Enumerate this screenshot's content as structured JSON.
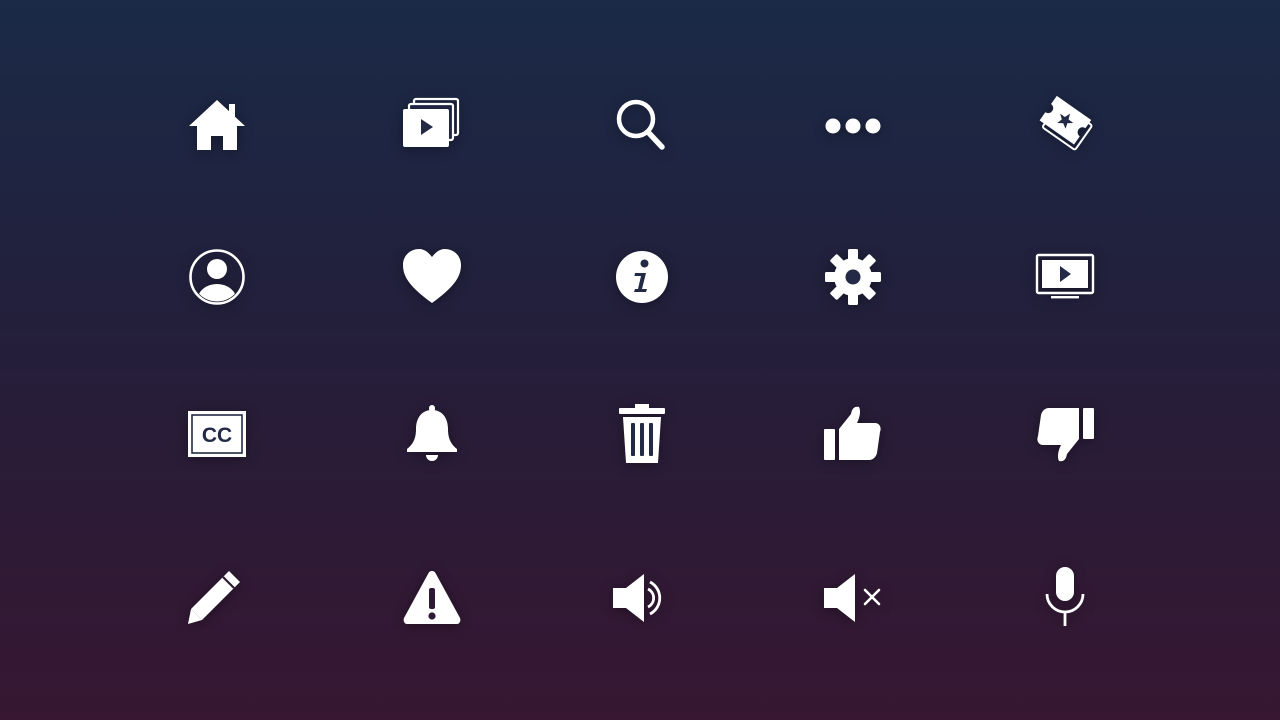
{
  "icon_color": "#ffffff",
  "icons": [
    {
      "name": "home-icon"
    },
    {
      "name": "video-library-icon"
    },
    {
      "name": "search-icon"
    },
    {
      "name": "more-horizontal-icon"
    },
    {
      "name": "ticket-icon"
    },
    {
      "name": "account-icon"
    },
    {
      "name": "heart-icon"
    },
    {
      "name": "info-icon"
    },
    {
      "name": "gear-icon"
    },
    {
      "name": "tv-play-icon"
    },
    {
      "name": "closed-captions-icon",
      "label": "CC"
    },
    {
      "name": "bell-icon"
    },
    {
      "name": "trash-icon"
    },
    {
      "name": "thumbs-up-icon"
    },
    {
      "name": "thumbs-down-icon"
    },
    {
      "name": "pencil-icon"
    },
    {
      "name": "warning-icon"
    },
    {
      "name": "volume-icon"
    },
    {
      "name": "mute-icon"
    },
    {
      "name": "microphone-icon"
    }
  ]
}
